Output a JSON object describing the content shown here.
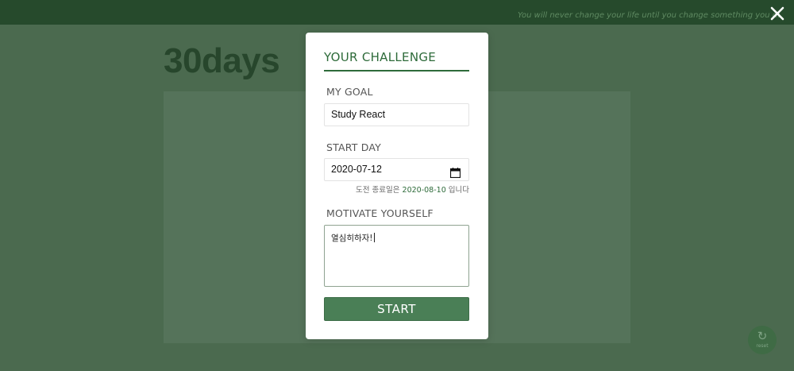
{
  "header": {
    "quote": "You will never change your life until you change something you do daily",
    "close_icon": "close-icon"
  },
  "brand": {
    "title": "30days"
  },
  "reset": {
    "icon": "refresh-icon",
    "label": "reset"
  },
  "modal": {
    "title": "YOUR CHALLENGE",
    "goal": {
      "label": "MY GOAL",
      "value": "Study React"
    },
    "start_day": {
      "label": "START DAY",
      "value": "2020-07-12",
      "icon": "calendar-icon"
    },
    "end_note": {
      "prefix": "도전 종료일은 ",
      "date": "2020-08-10",
      "suffix": " 입니다"
    },
    "motivate": {
      "label": "MOTIVATE YOURSELF",
      "value": "열심히하자!"
    },
    "start_button": "START"
  },
  "colors": {
    "overlay_bg": "#4b6a4f",
    "topbar": "#264a2c",
    "accent": "#2e6b3a",
    "button": "#4a7f56"
  }
}
